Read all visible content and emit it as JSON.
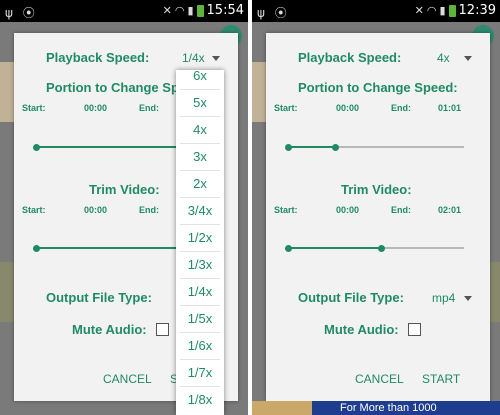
{
  "left": {
    "status": {
      "left_icons": "ψ ⦿",
      "time": "15:54",
      "battery_color": "#5fb536"
    },
    "dialog": {
      "playback_label": "Playback Speed:",
      "playback_value": "1/4x",
      "portion_label": "Portion to Change Sp",
      "portion_start_label": "Start:",
      "portion_start_value": "00:00",
      "portion_end_label": "End:",
      "portion_fill_fraction": 1.0,
      "trim_label": "Trim Video:",
      "trim_start_label": "Start:",
      "trim_start_value": "00:00",
      "trim_end_label": "End:",
      "trim_fill_fraction": 1.0,
      "output_label": "Output File Type:",
      "mute_label": "Mute Audio:",
      "mute_checked": false,
      "cancel_label": "CANCEL",
      "start_label": "S"
    },
    "menu": {
      "items": [
        "6x",
        "5x",
        "4x",
        "3x",
        "2x",
        "3/4x",
        "1/2x",
        "1/3x",
        "1/4x",
        "1/5x",
        "1/6x",
        "1/7x",
        "1/8x"
      ]
    }
  },
  "right": {
    "status": {
      "left_icons": "ψ ⦿",
      "time": "12:39",
      "battery_color": "#5fb536"
    },
    "dialog": {
      "playback_label": "Playback Speed:",
      "playback_value": "4x",
      "portion_label": "Portion to Change Speed:",
      "portion_start_label": "Start:",
      "portion_start_value": "00:00",
      "portion_end_label": "End:",
      "portion_end_value": "01:01",
      "portion_fill_fraction": 0.27,
      "trim_label": "Trim Video:",
      "trim_start_label": "Start:",
      "trim_start_value": "00:00",
      "trim_end_label": "End:",
      "trim_end_value": "02:01",
      "trim_fill_fraction": 0.53,
      "output_label": "Output File Type:",
      "output_value": "mp4",
      "mute_label": "Mute Audio:",
      "mute_checked": false,
      "cancel_label": "CANCEL",
      "start_label": "START"
    },
    "banner": {
      "text": "For More than 1000"
    }
  },
  "colors": {
    "accent": "#208b63",
    "dialog_bg": "#f2f2f2",
    "track": "#b8b8b8",
    "banner": "#1e3d8f"
  },
  "icons": [
    "usb-icon",
    "notification-icon",
    "mute-icon",
    "wifi-icon",
    "signal-icon",
    "battery-icon",
    "dropdown-caret-icon"
  ]
}
